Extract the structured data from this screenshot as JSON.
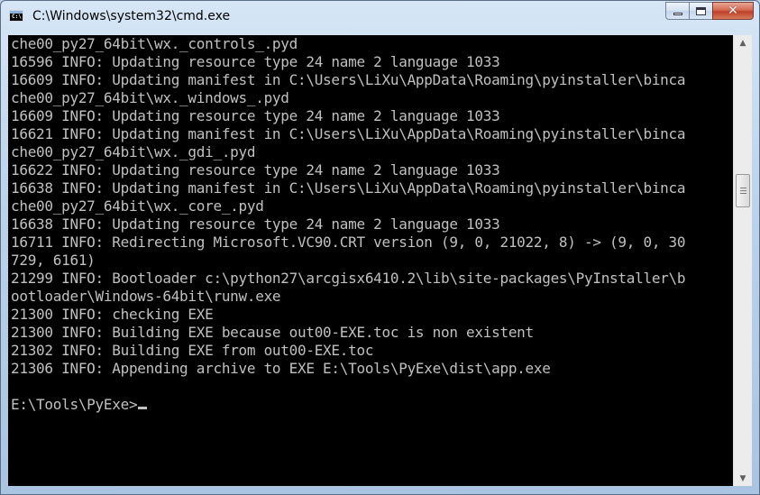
{
  "window": {
    "title": "C:\\Windows\\system32\\cmd.exe",
    "icon": "cmd-icon",
    "icon_label": "C:\\",
    "buttons": {
      "minimize_icon": "minimize-icon",
      "maximize_icon": "maximize-icon",
      "close_icon": "close-icon",
      "close_glyph": "✕"
    }
  },
  "console": {
    "lines": [
      "che00_py27_64bit\\wx._controls_.pyd",
      "16596 INFO: Updating resource type 24 name 2 language 1033",
      "16609 INFO: Updating manifest in C:\\Users\\LiXu\\AppData\\Roaming\\pyinstaller\\binca",
      "che00_py27_64bit\\wx._windows_.pyd",
      "16609 INFO: Updating resource type 24 name 2 language 1033",
      "16621 INFO: Updating manifest in C:\\Users\\LiXu\\AppData\\Roaming\\pyinstaller\\binca",
      "che00_py27_64bit\\wx._gdi_.pyd",
      "16622 INFO: Updating resource type 24 name 2 language 1033",
      "16638 INFO: Updating manifest in C:\\Users\\LiXu\\AppData\\Roaming\\pyinstaller\\binca",
      "che00_py27_64bit\\wx._core_.pyd",
      "16638 INFO: Updating resource type 24 name 2 language 1033",
      "16711 INFO: Redirecting Microsoft.VC90.CRT version (9, 0, 21022, 8) -> (9, 0, 30",
      "729, 6161)",
      "21299 INFO: Bootloader c:\\python27\\arcgisx6410.2\\lib\\site-packages\\PyInstaller\\b",
      "ootloader\\Windows-64bit\\runw.exe",
      "21300 INFO: checking EXE",
      "21300 INFO: Building EXE because out00-EXE.toc is non existent",
      "21302 INFO: Building EXE from out00-EXE.toc",
      "21306 INFO: Appending archive to EXE E:\\Tools\\PyExe\\dist\\app.exe",
      ""
    ],
    "prompt": "E:\\Tools\\PyExe>"
  },
  "scrollbar": {
    "up_arrow": "▲",
    "down_arrow": "▼",
    "position": 0.32
  }
}
